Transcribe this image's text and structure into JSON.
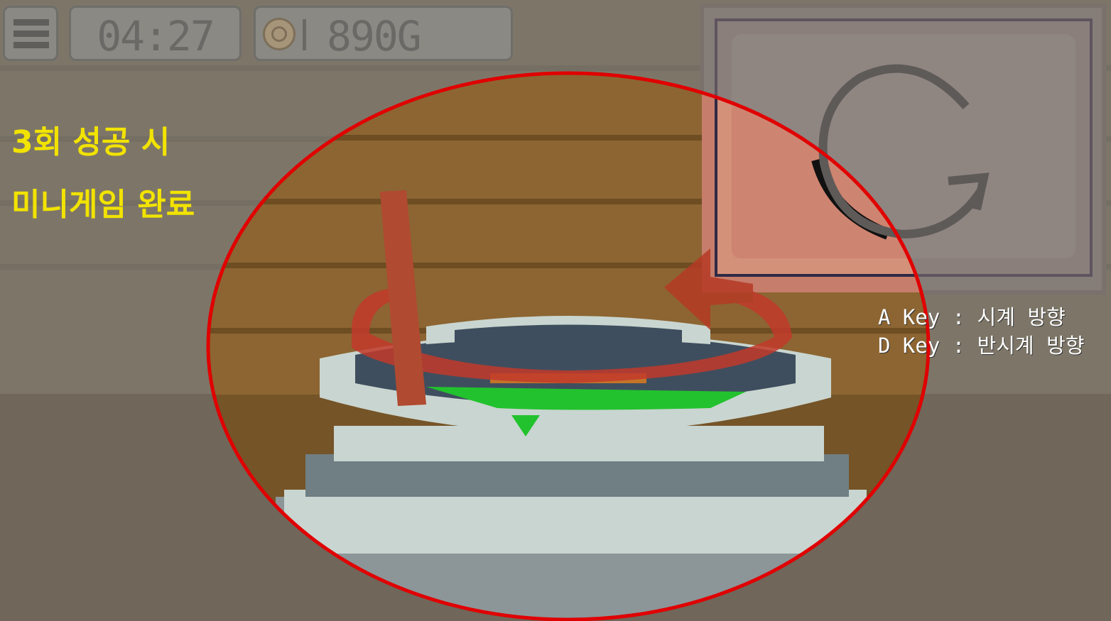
{
  "hud": {
    "timer": "04:27",
    "gold": "890G"
  },
  "annotation": {
    "line1": "3회 성공 시",
    "line2": "미니게임 완료"
  },
  "controls": {
    "a_key": "A Key : 시계 방향",
    "d_key": "D Key : 반시계 방향"
  },
  "colors": {
    "annotation_text": "#f2e300",
    "highlight_ellipse": "#e00000",
    "potion_liquid": "#22c22e",
    "rotate_panel": "#c77d6b"
  },
  "icons": {
    "menu": "hamburger-menu-icon",
    "coin": "coin-icon",
    "rotate": "rotate-clockwise-icon"
  }
}
